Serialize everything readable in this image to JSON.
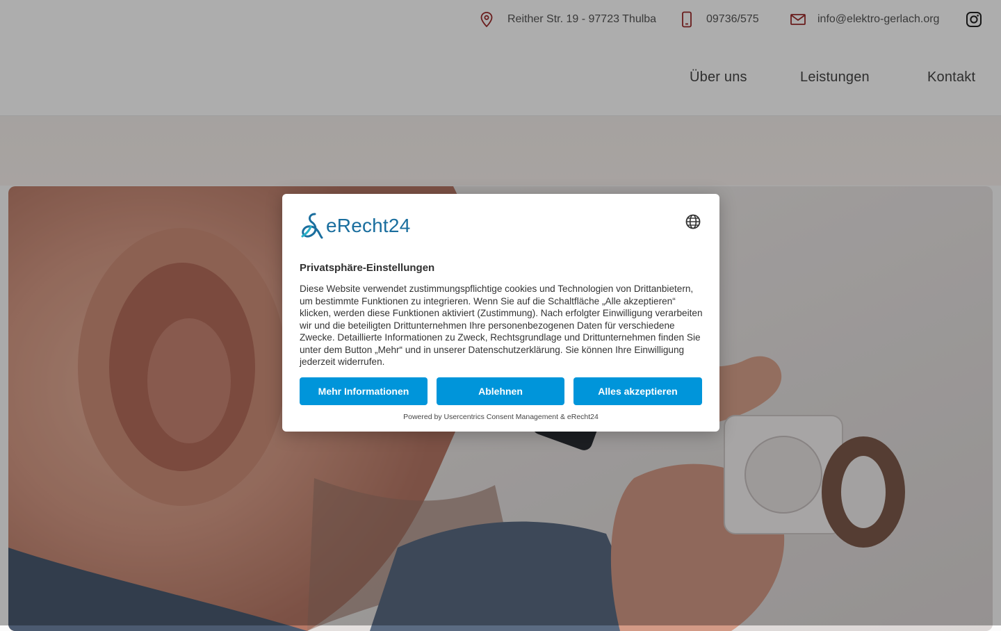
{
  "topbar": {
    "address": "Reither Str. 19 - 97723 Thulba",
    "phone": "09736/575",
    "email": "info@elektro-gerlach.org",
    "icons": [
      "map-pin-icon",
      "phone-icon",
      "mail-icon",
      "instagram-icon"
    ],
    "icon_color": "#9b2a2a"
  },
  "nav": {
    "items": [
      {
        "label": "Über uns"
      },
      {
        "label": "Leistungen"
      },
      {
        "label": "Kontakt"
      }
    ]
  },
  "consent": {
    "brand": "eRecht24",
    "language_icon": "globe-icon",
    "title": "Privatsphäre-Einstellungen",
    "body": "Diese Website verwendet zustimmungspflichtige cookies und Technologien von Drittanbietern, um bestimmte Funktionen zu integrieren. Wenn Sie auf die Schaltfläche „Alle akzeptieren“ klicken, werden diese Funktionen aktiviert (Zustimmung). Nach erfolgter Einwilligung verarbeiten wir und die beteiligten Drittunternehmen Ihre personenbezogenen Daten für verschiedene Zwecke. Detaillierte Informationen zu Zweck, Rechtsgrundlage und Drittunternehmen finden Sie unter dem Button „Mehr“ und in unserer Datenschutzerklärung. Sie können Ihre Einwilligung jederzeit widerrufen.",
    "buttons": {
      "more": "Mehr Informationen",
      "decline": "Ablehnen",
      "accept": "Alles akzeptieren"
    },
    "powered_by": "Powered by Usercentrics Consent Management & eRecht24",
    "button_color": "#0095da",
    "brand_color": "#1a6e9e"
  }
}
